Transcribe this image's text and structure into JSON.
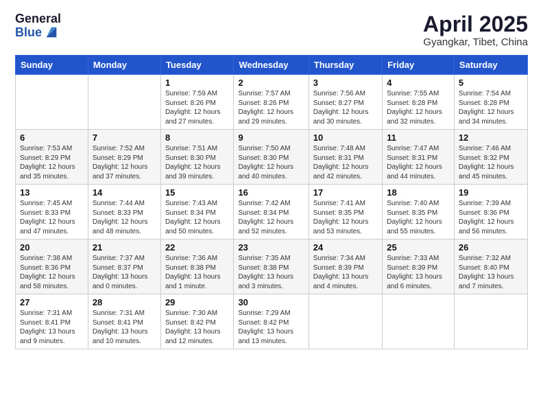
{
  "logo": {
    "general": "General",
    "blue": "Blue"
  },
  "title": {
    "month": "April 2025",
    "location": "Gyangkar, Tibet, China"
  },
  "weekdays": [
    "Sunday",
    "Monday",
    "Tuesday",
    "Wednesday",
    "Thursday",
    "Friday",
    "Saturday"
  ],
  "weeks": [
    [
      {
        "day": "",
        "info": ""
      },
      {
        "day": "",
        "info": ""
      },
      {
        "day": "1",
        "info": "Sunrise: 7:59 AM\nSunset: 8:26 PM\nDaylight: 12 hours and 27 minutes."
      },
      {
        "day": "2",
        "info": "Sunrise: 7:57 AM\nSunset: 8:26 PM\nDaylight: 12 hours and 29 minutes."
      },
      {
        "day": "3",
        "info": "Sunrise: 7:56 AM\nSunset: 8:27 PM\nDaylight: 12 hours and 30 minutes."
      },
      {
        "day": "4",
        "info": "Sunrise: 7:55 AM\nSunset: 8:28 PM\nDaylight: 12 hours and 32 minutes."
      },
      {
        "day": "5",
        "info": "Sunrise: 7:54 AM\nSunset: 8:28 PM\nDaylight: 12 hours and 34 minutes."
      }
    ],
    [
      {
        "day": "6",
        "info": "Sunrise: 7:53 AM\nSunset: 8:29 PM\nDaylight: 12 hours and 35 minutes."
      },
      {
        "day": "7",
        "info": "Sunrise: 7:52 AM\nSunset: 8:29 PM\nDaylight: 12 hours and 37 minutes."
      },
      {
        "day": "8",
        "info": "Sunrise: 7:51 AM\nSunset: 8:30 PM\nDaylight: 12 hours and 39 minutes."
      },
      {
        "day": "9",
        "info": "Sunrise: 7:50 AM\nSunset: 8:30 PM\nDaylight: 12 hours and 40 minutes."
      },
      {
        "day": "10",
        "info": "Sunrise: 7:48 AM\nSunset: 8:31 PM\nDaylight: 12 hours and 42 minutes."
      },
      {
        "day": "11",
        "info": "Sunrise: 7:47 AM\nSunset: 8:31 PM\nDaylight: 12 hours and 44 minutes."
      },
      {
        "day": "12",
        "info": "Sunrise: 7:46 AM\nSunset: 8:32 PM\nDaylight: 12 hours and 45 minutes."
      }
    ],
    [
      {
        "day": "13",
        "info": "Sunrise: 7:45 AM\nSunset: 8:33 PM\nDaylight: 12 hours and 47 minutes."
      },
      {
        "day": "14",
        "info": "Sunrise: 7:44 AM\nSunset: 8:33 PM\nDaylight: 12 hours and 48 minutes."
      },
      {
        "day": "15",
        "info": "Sunrise: 7:43 AM\nSunset: 8:34 PM\nDaylight: 12 hours and 50 minutes."
      },
      {
        "day": "16",
        "info": "Sunrise: 7:42 AM\nSunset: 8:34 PM\nDaylight: 12 hours and 52 minutes."
      },
      {
        "day": "17",
        "info": "Sunrise: 7:41 AM\nSunset: 8:35 PM\nDaylight: 12 hours and 53 minutes."
      },
      {
        "day": "18",
        "info": "Sunrise: 7:40 AM\nSunset: 8:35 PM\nDaylight: 12 hours and 55 minutes."
      },
      {
        "day": "19",
        "info": "Sunrise: 7:39 AM\nSunset: 8:36 PM\nDaylight: 12 hours and 56 minutes."
      }
    ],
    [
      {
        "day": "20",
        "info": "Sunrise: 7:38 AM\nSunset: 8:36 PM\nDaylight: 12 hours and 58 minutes."
      },
      {
        "day": "21",
        "info": "Sunrise: 7:37 AM\nSunset: 8:37 PM\nDaylight: 13 hours and 0 minutes."
      },
      {
        "day": "22",
        "info": "Sunrise: 7:36 AM\nSunset: 8:38 PM\nDaylight: 13 hours and 1 minute."
      },
      {
        "day": "23",
        "info": "Sunrise: 7:35 AM\nSunset: 8:38 PM\nDaylight: 13 hours and 3 minutes."
      },
      {
        "day": "24",
        "info": "Sunrise: 7:34 AM\nSunset: 8:39 PM\nDaylight: 13 hours and 4 minutes."
      },
      {
        "day": "25",
        "info": "Sunrise: 7:33 AM\nSunset: 8:39 PM\nDaylight: 13 hours and 6 minutes."
      },
      {
        "day": "26",
        "info": "Sunrise: 7:32 AM\nSunset: 8:40 PM\nDaylight: 13 hours and 7 minutes."
      }
    ],
    [
      {
        "day": "27",
        "info": "Sunrise: 7:31 AM\nSunset: 8:41 PM\nDaylight: 13 hours and 9 minutes."
      },
      {
        "day": "28",
        "info": "Sunrise: 7:31 AM\nSunset: 8:41 PM\nDaylight: 13 hours and 10 minutes."
      },
      {
        "day": "29",
        "info": "Sunrise: 7:30 AM\nSunset: 8:42 PM\nDaylight: 13 hours and 12 minutes."
      },
      {
        "day": "30",
        "info": "Sunrise: 7:29 AM\nSunset: 8:42 PM\nDaylight: 13 hours and 13 minutes."
      },
      {
        "day": "",
        "info": ""
      },
      {
        "day": "",
        "info": ""
      },
      {
        "day": "",
        "info": ""
      }
    ]
  ]
}
